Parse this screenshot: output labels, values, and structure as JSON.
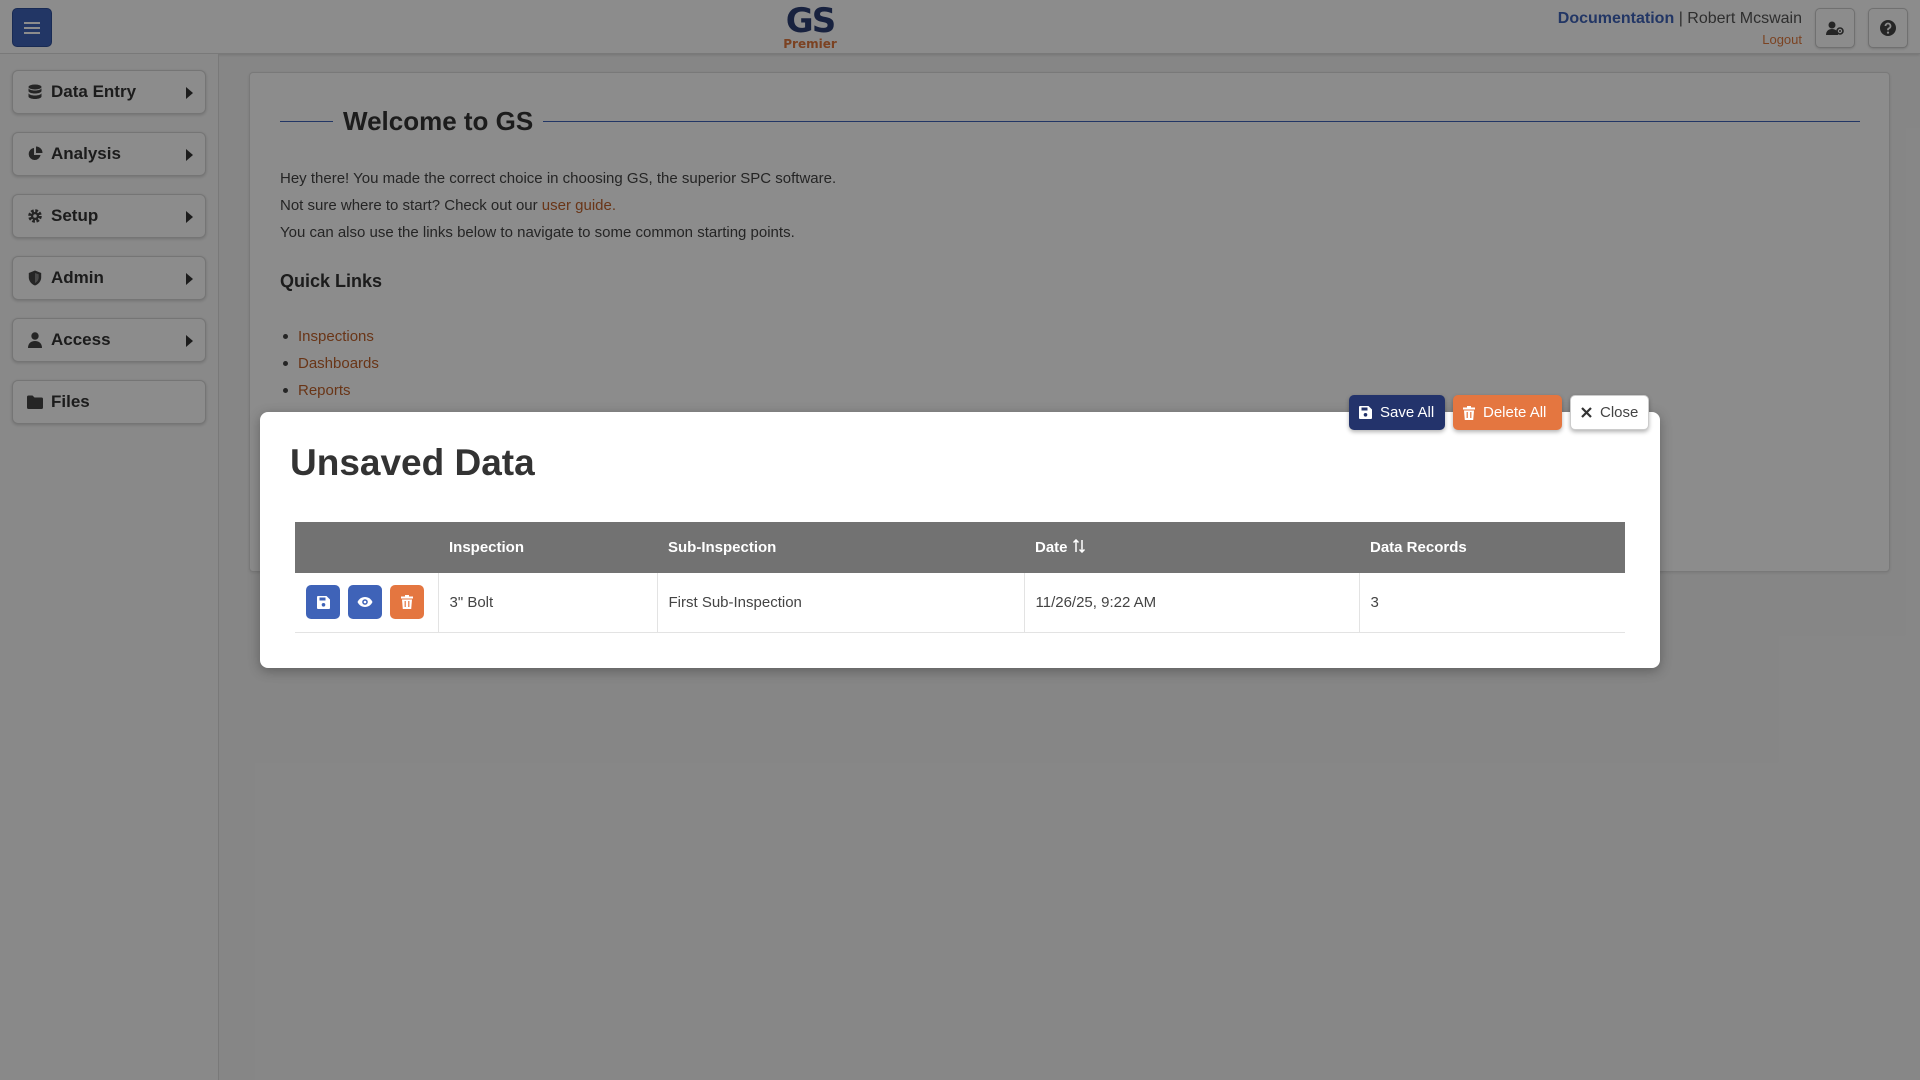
{
  "header": {
    "logo_main": "GS",
    "logo_sub": "Premier",
    "documentation": "Documentation",
    "separator": "|",
    "user_name": "Robert Mcswain",
    "logout": "Logout"
  },
  "sidebar": {
    "items": [
      {
        "label": "Data Entry",
        "icon": "database-icon"
      },
      {
        "label": "Analysis",
        "icon": "pie-chart-icon"
      },
      {
        "label": "Setup",
        "icon": "gear-icon"
      },
      {
        "label": "Admin",
        "icon": "shield-icon"
      },
      {
        "label": "Access",
        "icon": "user-icon"
      },
      {
        "label": "Files",
        "icon": "folder-icon"
      }
    ]
  },
  "main": {
    "title": "Welcome to GS",
    "intro_line1": "Hey there! You made the correct choice in choosing GS, the superior SPC software.",
    "intro_line2_pre": "Not sure where to start? Check out our ",
    "intro_line2_link": "user guide.",
    "intro_line3": "You can also use the links below to navigate to some common starting points.",
    "quick_links_title": "Quick Links",
    "quick_links": [
      "Inspections",
      "Dashboards",
      "Reports"
    ]
  },
  "modal": {
    "title": "Unsaved Data",
    "save_all": "Save All",
    "delete_all": "Delete All",
    "close": "Close",
    "columns": [
      "Inspection",
      "Sub-Inspection",
      "Date",
      "Data Records"
    ],
    "rows": [
      {
        "inspection": "3\" Bolt",
        "sub_inspection": "First Sub-Inspection",
        "date": "11/26/25, 9:22 AM",
        "data_records": "3"
      }
    ]
  },
  "colors": {
    "primary": "#3f63b8",
    "dark_navy": "#23336b",
    "accent_orange": "#e47640",
    "link": "#c0622b"
  }
}
